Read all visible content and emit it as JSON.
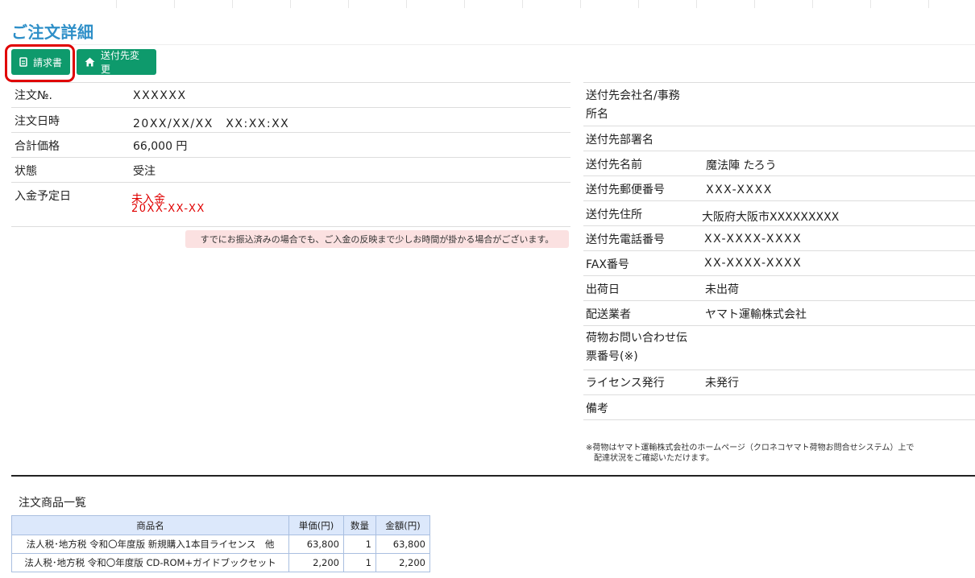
{
  "page_title": "ご注文詳細",
  "buttons": {
    "invoice": "請求書",
    "change_ship": "送付先変更"
  },
  "order": {
    "no_label": "注文№.",
    "no_value": "XXXXXX",
    "date_label": "注文日時",
    "date_value": "20XX/XX/XX　XX:XX:XX",
    "total_label": "合計価格",
    "total_value": "66,000 円",
    "status_label": "状態",
    "status_value": "受注",
    "payment_label": "入金予定日",
    "payment_status": "未入金",
    "payment_date": "20XX-XX-XX",
    "notice": "すでにお振込済みの場合でも、ご入金の反映まで少しお時間が掛かる場合がございます。"
  },
  "shipping": {
    "company_label": "送付先会社名/事務\n所名",
    "company_value": "",
    "dept_label": "送付先部署名",
    "dept_value": "",
    "name_label": "送付先名前",
    "name_value": "魔法陣 たろう",
    "zip_label": "送付先郵便番号",
    "zip_value": "XXX-XXXX",
    "address_label": "送付先住所",
    "address_value": "大阪府大阪市XXXXXXXXX",
    "tel_label": "送付先電話番号",
    "tel_value": "XX-XXXX-XXXX",
    "fax_label": "FAX番号",
    "fax_value": "XX-XXXX-XXXX",
    "ship_date_label": "出荷日",
    "ship_date_value": "未出荷",
    "carrier_label": "配送業者",
    "carrier_value": "ヤマト運輸株式会社",
    "tracking_label": "荷物お問い合わせ伝\n票番号(※)",
    "tracking_value": "",
    "license_label": "ライセンス発行",
    "license_value": "未発行",
    "remarks_label": "備考",
    "remarks_value": "",
    "footnote_line1": "※荷物はヤマト運輸株式会社のホームページ（クロネコヤマト荷物お問合せシステム）上で",
    "footnote_line2": "配達状況をご確認いただけます。"
  },
  "items_section_title": "注文商品一覧",
  "items_table": {
    "headers": [
      "商品名",
      "単価(円)",
      "数量",
      "金額(円)"
    ],
    "rows": [
      [
        "法人税･地方税 令和〇年度版 新規購入1本目ライセンス　他",
        "63,800",
        "1",
        "63,800"
      ],
      [
        "法人税･地方税 令和〇年度版 CD-ROM+ガイドブックセット",
        "2,200",
        "1",
        "2,200"
      ]
    ]
  },
  "colors": {
    "title_blue": "#2e8fc8",
    "button_green": "#0e9a6c",
    "highlight_red": "#e00000",
    "notice_pink": "#fbe1e1",
    "table_header_blue": "#dce8fb"
  },
  "icons": {
    "invoice_icon": "document-icon",
    "ship_icon": "home-icon"
  }
}
